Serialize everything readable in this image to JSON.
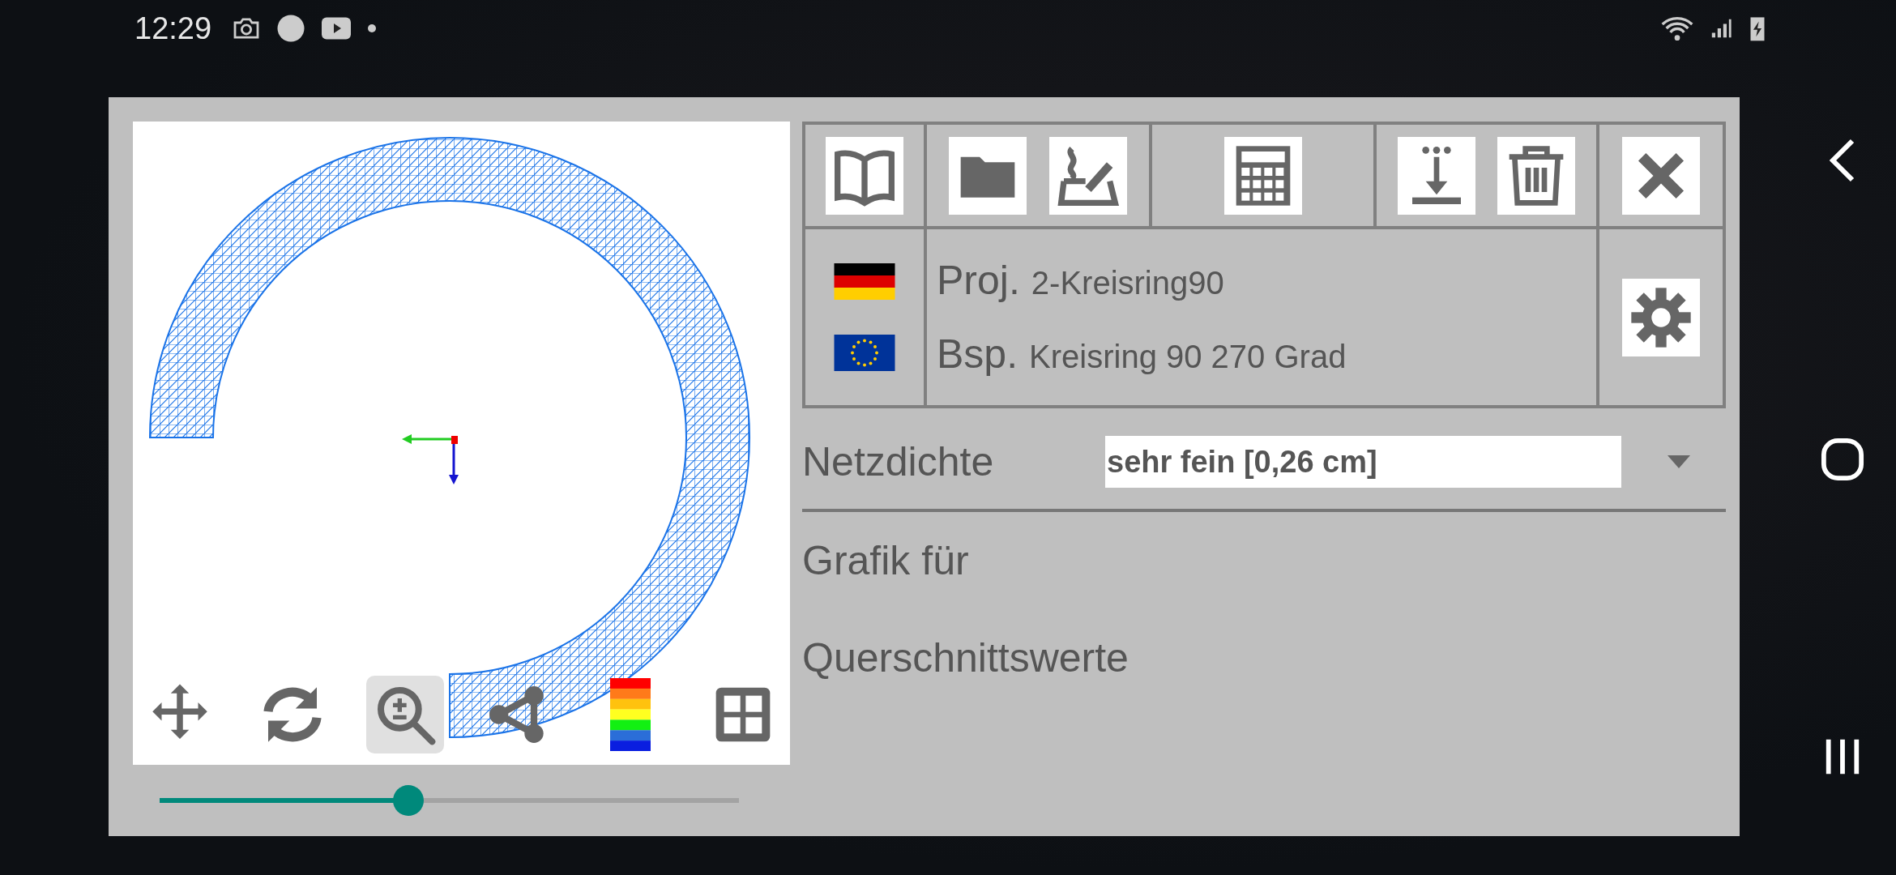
{
  "status_bar": {
    "time": "12:29"
  },
  "project": [
    {
      "label": "Proj.",
      "value": "2-Kreisring90"
    },
    {
      "label": "Bsp.",
      "value": "Kreisring 90 270 Grad"
    }
  ],
  "mesh_density": {
    "label": "Netzdichte",
    "value": "sehr fein [0,26 cm]"
  },
  "sections": [
    "Grafik für",
    "Querschnittswerte"
  ],
  "canvas_tools": [
    {
      "kind": "move",
      "selected": false
    },
    {
      "kind": "rotate",
      "selected": false
    },
    {
      "kind": "zoom",
      "selected": true
    },
    {
      "kind": "nodes",
      "selected": false
    },
    {
      "kind": "colors",
      "selected": false
    },
    {
      "kind": "fit",
      "selected": false
    }
  ],
  "slider": {
    "level": 0.43
  }
}
